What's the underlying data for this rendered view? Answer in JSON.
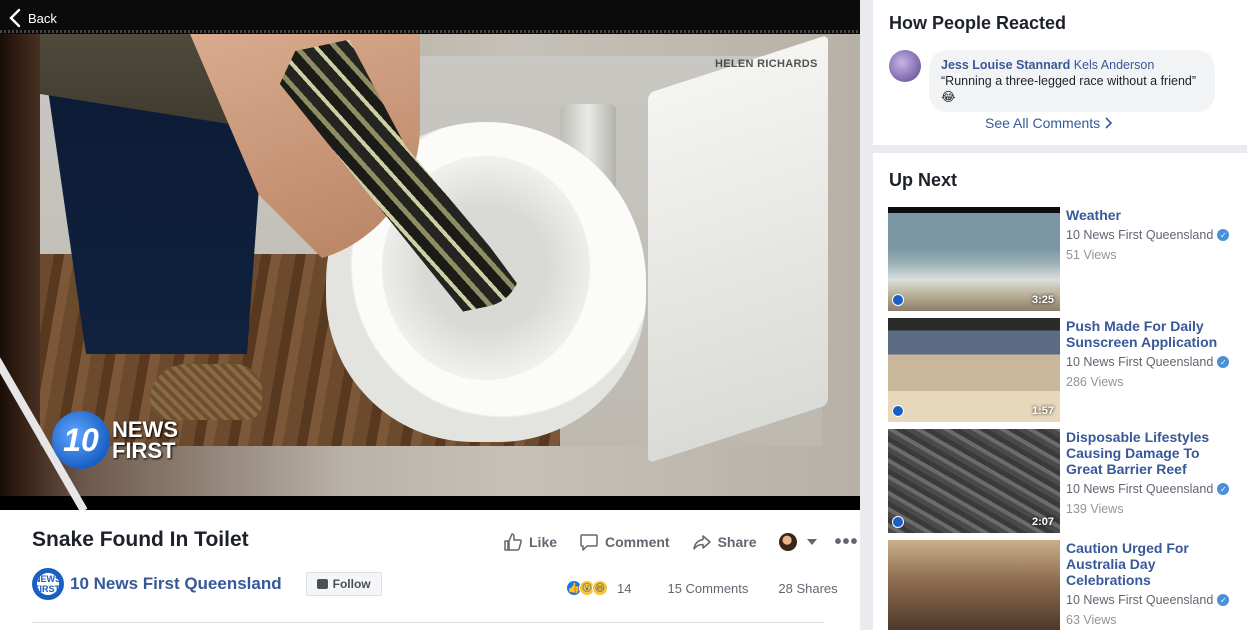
{
  "player": {
    "back_label": "Back",
    "watermark": "HELEN RICHARDS",
    "logo_number": "10",
    "logo_line1": "NEWS",
    "logo_line2": "FIRST"
  },
  "post": {
    "title": "Snake Found In Toilet",
    "page_name": "10 News First Queensland",
    "page_logo_text": "NEWS FIRST",
    "follow_label": "Follow",
    "actions": {
      "like": "Like",
      "comment": "Comment",
      "share": "Share"
    },
    "reaction_count": "14",
    "comments_count": "15 Comments",
    "shares_count": "28 Shares"
  },
  "reacted": {
    "heading": "How People Reacted",
    "comment": {
      "author": "Jess Louise Stannard",
      "tagged": "Kels Anderson",
      "text": "“Running a three-legged race without a friend” 😂"
    },
    "see_all": "See All Comments"
  },
  "up_next": {
    "heading": "Up Next",
    "videos": [
      {
        "title": "Weather",
        "page": "10 News First Queensland",
        "views": "51 Views",
        "duration": "3:25"
      },
      {
        "title": "Push Made For Daily Sunscreen Application",
        "page": "10 News First Queensland",
        "views": "286 Views",
        "duration": "1:57"
      },
      {
        "title": "Disposable Lifestyles Causing Damage To Great Barrier Reef",
        "page": "10 News First Queensland",
        "views": "139 Views",
        "duration": "2:07"
      },
      {
        "title": "Caution Urged For Australia Day Celebrations",
        "page": "10 News First Queensland",
        "views": "63 Views",
        "duration": ""
      }
    ]
  },
  "colors": {
    "link": "#385898",
    "brand_blue": "#1b5fc4",
    "like_blue": "#1877f2"
  }
}
